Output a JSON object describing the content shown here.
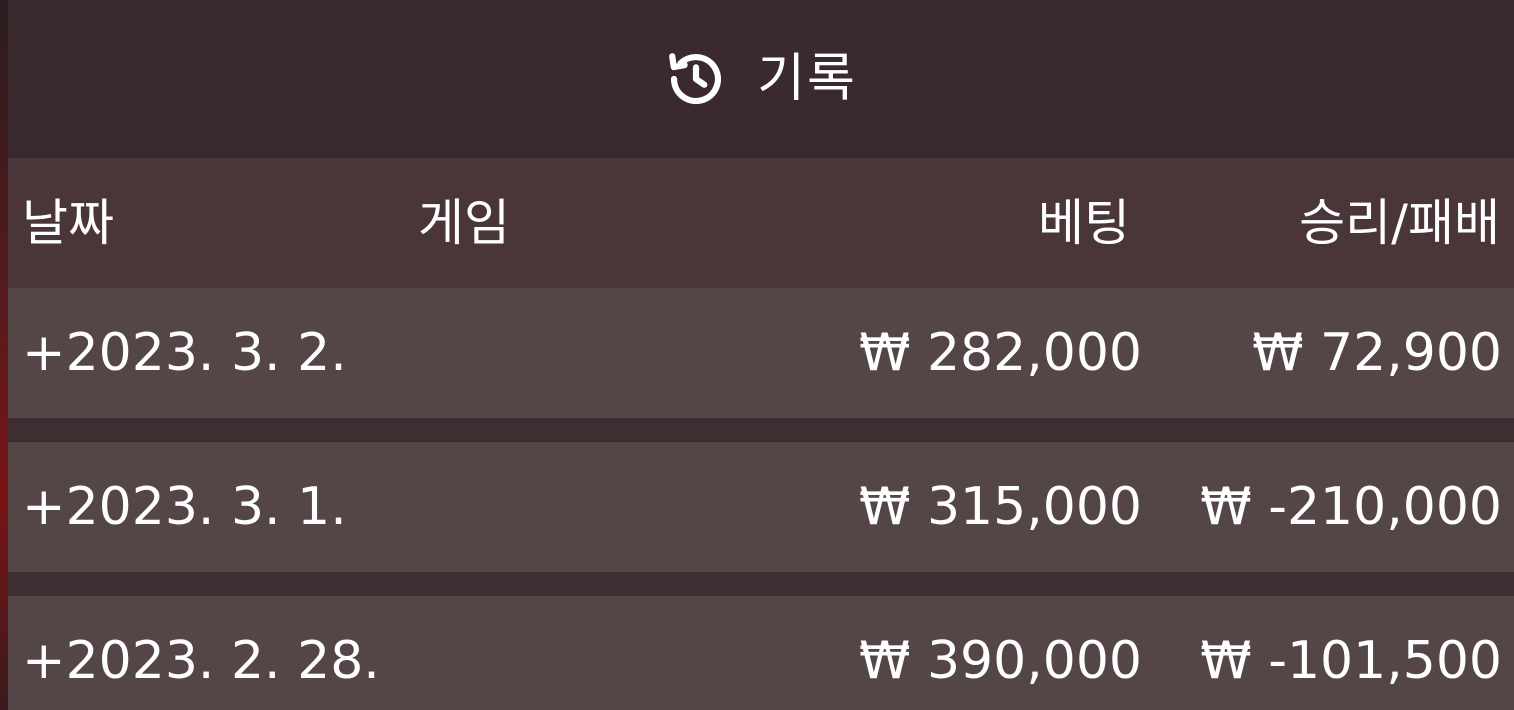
{
  "title": {
    "icon": "history-icon",
    "text": "기록"
  },
  "columns": {
    "date": "날짜",
    "game": "게임",
    "bet": "베팅",
    "winloss": "승리/패배"
  },
  "rows": [
    {
      "date": "+2023. 3. 2.",
      "game": "",
      "bet": "₩ 282,000",
      "winloss": "₩ 72,900"
    },
    {
      "date": "+2023. 3. 1.",
      "game": "",
      "bet": "₩ 315,000",
      "winloss": "₩ -210,000"
    },
    {
      "date": "+2023. 2. 28.",
      "game": "",
      "bet": "₩ 390,000",
      "winloss": "₩ -101,500"
    }
  ],
  "colors": {
    "background": "#3b2b2e",
    "header_row": "#4a3639",
    "data_row": "#544547",
    "text": "#ffffff"
  }
}
